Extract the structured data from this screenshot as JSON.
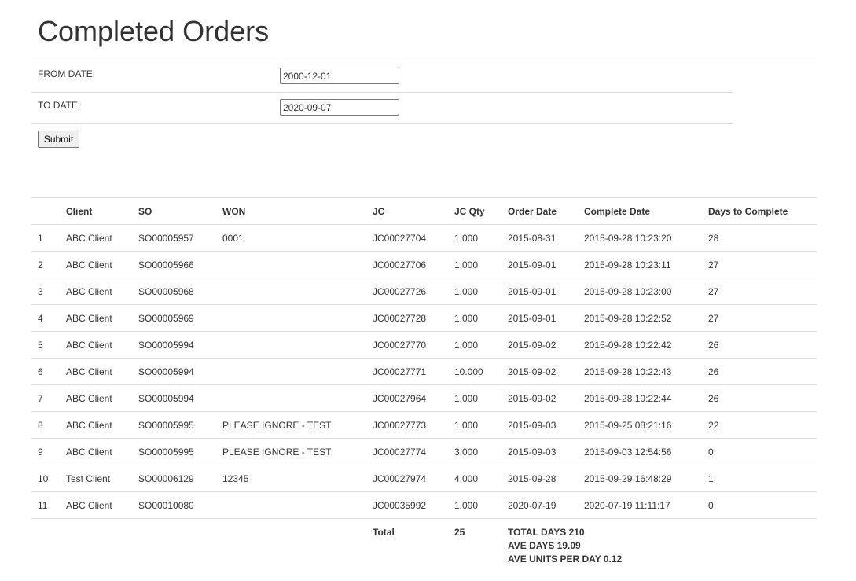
{
  "page": {
    "title": "Completed Orders"
  },
  "filters": {
    "from_label": "FROM DATE:",
    "from_value": "2000-12-01",
    "to_label": "TO DATE:",
    "to_value": "2020-09-07",
    "submit_label": "Submit"
  },
  "table": {
    "headers": [
      "",
      "Client",
      "SO",
      "WON",
      "JC",
      "JC Qty",
      "Order Date",
      "Complete Date",
      "Days to Complete"
    ],
    "rows": [
      [
        "1",
        "ABC Client",
        "SO00005957",
        "0001",
        "JC00027704",
        "1.000",
        "2015-08-31",
        "2015-09-28 10:23:20",
        "28"
      ],
      [
        "2",
        "ABC Client",
        "SO00005966",
        "",
        "JC00027706",
        "1.000",
        "2015-09-01",
        "2015-09-28 10:23:11",
        "27"
      ],
      [
        "3",
        "ABC Client",
        "SO00005968",
        "",
        "JC00027726",
        "1.000",
        "2015-09-01",
        "2015-09-28 10:23:00",
        "27"
      ],
      [
        "4",
        "ABC Client",
        "SO00005969",
        "",
        "JC00027728",
        "1.000",
        "2015-09-01",
        "2015-09-28 10:22:52",
        "27"
      ],
      [
        "5",
        "ABC Client",
        "SO00005994",
        "",
        "JC00027770",
        "1.000",
        "2015-09-02",
        "2015-09-28 10:22:42",
        "26"
      ],
      [
        "6",
        "ABC Client",
        "SO00005994",
        "",
        "JC00027771",
        "10.000",
        "2015-09-02",
        "2015-09-28 10:22:43",
        "26"
      ],
      [
        "7",
        "ABC Client",
        "SO00005994",
        "",
        "JC00027964",
        "1.000",
        "2015-09-02",
        "2015-09-28 10:22:44",
        "26"
      ],
      [
        "8",
        "ABC Client",
        "SO00005995",
        "PLEASE IGNORE - TEST",
        "JC00027773",
        "1.000",
        "2015-09-03",
        "2015-09-25 08:21:16",
        "22"
      ],
      [
        "9",
        "ABC Client",
        "SO00005995",
        "PLEASE IGNORE - TEST",
        "JC00027774",
        "3.000",
        "2015-09-03",
        "2015-09-03 12:54:56",
        "0"
      ],
      [
        "10",
        "Test Client",
        "SO00006129",
        "12345",
        "JC00027974",
        "4.000",
        "2015-09-28",
        "2015-09-29 16:48:29",
        "1"
      ],
      [
        "11",
        "ABC Client",
        "SO00010080",
        "",
        "JC00035992",
        "1.000",
        "2020-07-19",
        "2020-07-19 11:11:17",
        "0"
      ]
    ],
    "footer": {
      "total_label": "Total",
      "total_qty": "25",
      "summary_lines": [
        "TOTAL DAYS 210",
        "AVE DAYS 19.09",
        "AVE UNITS PER DAY 0.12"
      ]
    }
  }
}
